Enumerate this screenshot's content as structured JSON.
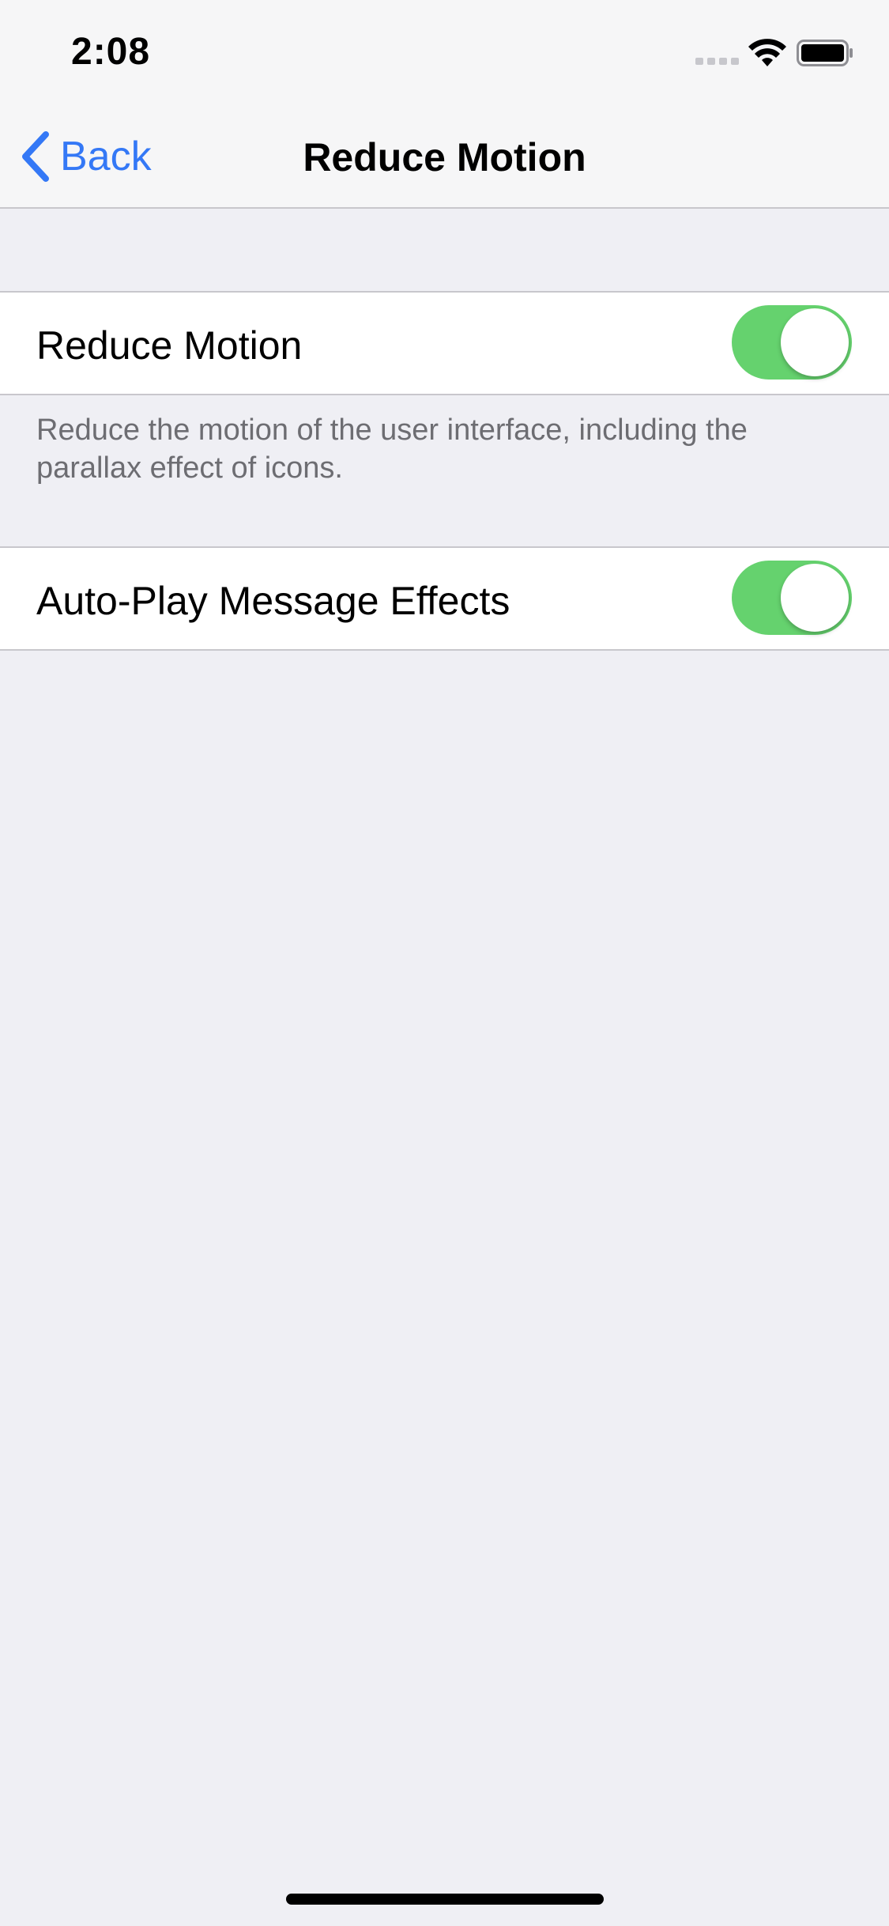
{
  "status_bar": {
    "time": "2:08",
    "icons": [
      "signal-icon",
      "wifi-icon",
      "battery-icon"
    ]
  },
  "nav": {
    "back_label": "Back",
    "title": "Reduce Motion"
  },
  "settings": {
    "reduce_motion": {
      "label": "Reduce Motion",
      "enabled": true,
      "footer": "Reduce the motion of the user interface, including the parallax effect of icons."
    },
    "auto_play_effects": {
      "label": "Auto-Play Message Effects",
      "enabled": true
    }
  },
  "colors": {
    "accent": "#3478f6",
    "toggle_on": "#65d26e",
    "background": "#efeff4"
  }
}
